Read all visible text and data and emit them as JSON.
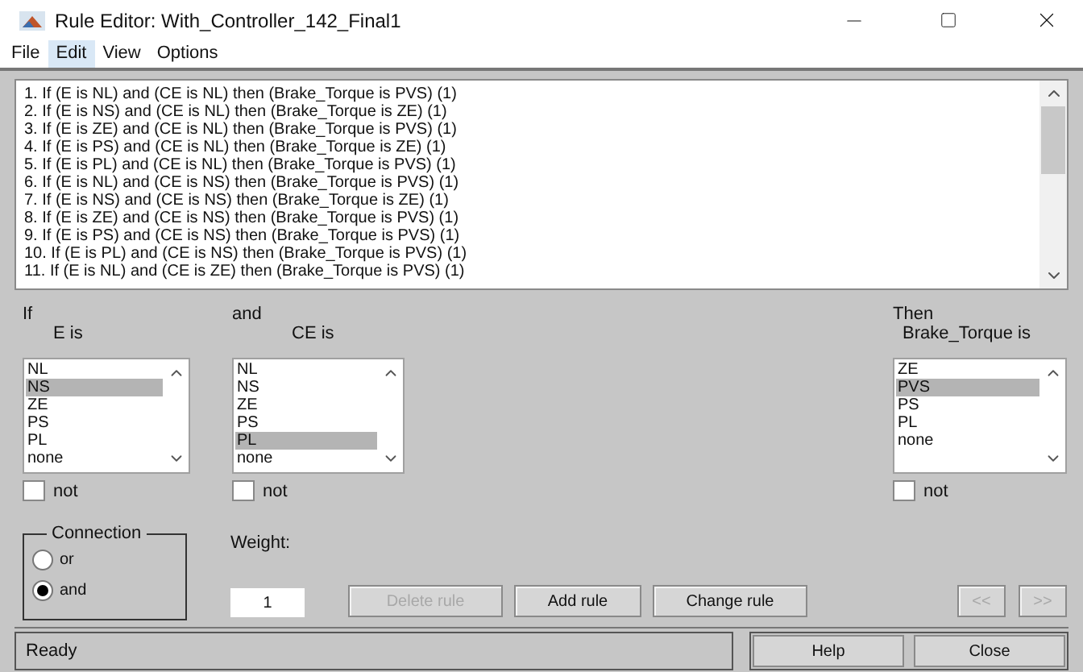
{
  "window": {
    "title": "Rule Editor: With_Controller_142_Final1"
  },
  "menu": [
    {
      "label": "File",
      "selected": false
    },
    {
      "label": "Edit",
      "selected": true
    },
    {
      "label": "View",
      "selected": false
    },
    {
      "label": "Options",
      "selected": false
    }
  ],
  "rules": [
    "1. If (E is NL) and (CE is NL) then (Brake_Torque is PVS) (1)",
    "2. If (E is NS) and (CE is NL) then (Brake_Torque is ZE) (1)",
    "3. If (E is ZE) and (CE is NL) then (Brake_Torque is PVS) (1)",
    "4. If (E is PS) and (CE is NL) then (Brake_Torque is ZE) (1)",
    "5. If (E is PL) and (CE is NL) then (Brake_Torque is PVS) (1)",
    "6. If (E is NL) and (CE is NS) then (Brake_Torque is PVS) (1)",
    "7. If (E is NS) and (CE is NS) then (Brake_Torque is ZE) (1)",
    "8. If (E is ZE) and (CE is NS) then (Brake_Torque is PVS) (1)",
    "9. If (E is PS) and (CE is NS) then (Brake_Torque is PVS) (1)",
    "10. If (E is PL) and (CE is NS) then (Brake_Torque is PVS) (1)",
    "11. If (E is NL) and (CE is ZE) then (Brake_Torque is PVS) (1)"
  ],
  "antecedents": [
    {
      "header": "If",
      "label": "E is",
      "options": [
        {
          "label": "NL",
          "selected": false
        },
        {
          "label": "NS",
          "selected": true
        },
        {
          "label": "ZE",
          "selected": false
        },
        {
          "label": "PS",
          "selected": false
        },
        {
          "label": "PL",
          "selected": false
        },
        {
          "label": "none",
          "selected": false
        }
      ],
      "not": {
        "label": "not",
        "checked": false
      }
    },
    {
      "header": "and",
      "label": "CE is",
      "options": [
        {
          "label": "NL",
          "selected": false
        },
        {
          "label": "NS",
          "selected": false
        },
        {
          "label": "ZE",
          "selected": false
        },
        {
          "label": "PS",
          "selected": false
        },
        {
          "label": "PL",
          "selected": true
        },
        {
          "label": "none",
          "selected": false
        }
      ],
      "not": {
        "label": "not",
        "checked": false
      }
    }
  ],
  "consequent": {
    "header": "Then",
    "label": "Brake_Torque is",
    "options": [
      {
        "label": "ZE",
        "selected": false
      },
      {
        "label": "PVS",
        "selected": true
      },
      {
        "label": "PS",
        "selected": false
      },
      {
        "label": "PL",
        "selected": false
      },
      {
        "label": "none",
        "selected": false
      }
    ],
    "not": {
      "label": "not",
      "checked": false
    }
  },
  "connection": {
    "title": "Connection",
    "options": [
      {
        "label": "or",
        "selected": false
      },
      {
        "label": "and",
        "selected": true
      }
    ]
  },
  "weight": {
    "label": "Weight:",
    "value": "1"
  },
  "buttons": [
    {
      "label": "Delete rule",
      "disabled": true
    },
    {
      "label": "Add rule",
      "disabled": false
    },
    {
      "label": "Change rule",
      "disabled": false
    }
  ],
  "nav_buttons": [
    {
      "label": "<<",
      "disabled": true
    },
    {
      "label": ">>",
      "disabled": true
    }
  ],
  "status_bar": {
    "text": "Ready"
  },
  "footer_buttons": [
    "Help",
    "Close"
  ]
}
